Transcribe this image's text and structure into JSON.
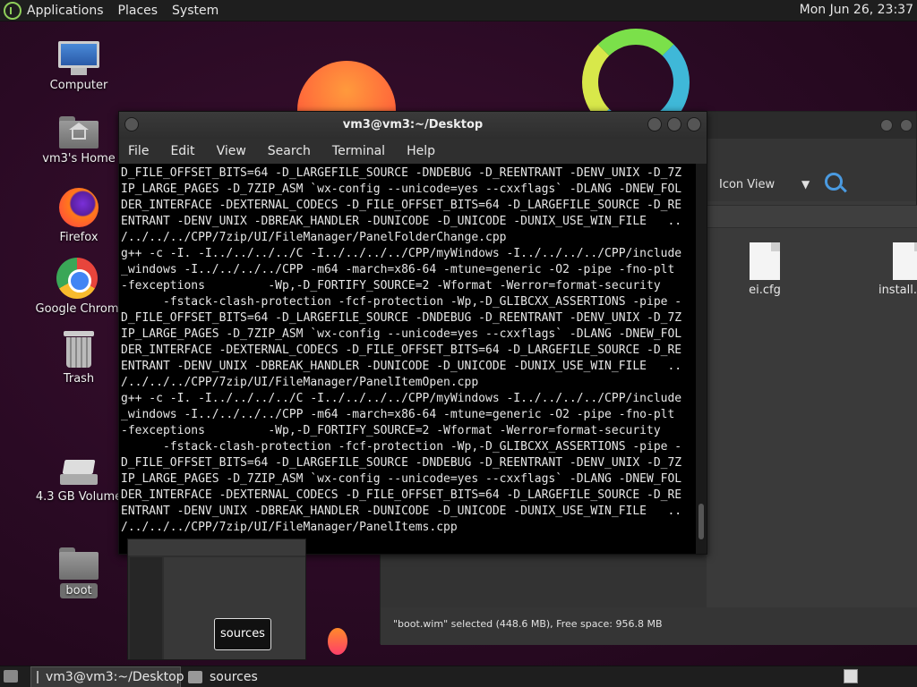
{
  "top_panel": {
    "menus": [
      "Applications",
      "Places",
      "System"
    ],
    "clock": "Mon Jun 26, 23:37"
  },
  "desktop_icons": [
    {
      "label": "Computer",
      "icon": "computer-icon"
    },
    {
      "label": "vm3's Home",
      "icon": "home-folder-icon"
    },
    {
      "label": "Firefox",
      "icon": "firefox-icon"
    },
    {
      "label": "Google Chrom",
      "icon": "chrome-icon"
    },
    {
      "label": "Trash",
      "icon": "trash-icon"
    },
    {
      "label": "4.3 GB Volume",
      "icon": "drive-icon"
    },
    {
      "label": "boot",
      "icon": "folder-icon"
    }
  ],
  "terminal": {
    "title": "vm3@vm3:~/Desktop",
    "menus": [
      "File",
      "Edit",
      "View",
      "Search",
      "Terminal",
      "Help"
    ],
    "lines": [
      "D_FILE_OFFSET_BITS=64 -D_LARGEFILE_SOURCE -DNDEBUG -D_REENTRANT -DENV_UNIX -D_7Z",
      "IP_LARGE_PAGES -D_7ZIP_ASM `wx-config --unicode=yes --cxxflags` -DLANG -DNEW_FOL",
      "DER_INTERFACE -DEXTERNAL_CODECS -D_FILE_OFFSET_BITS=64 -D_LARGEFILE_SOURCE -D_RE",
      "ENTRANT -DENV_UNIX -DBREAK_HANDLER -DUNICODE -D_UNICODE -DUNIX_USE_WIN_FILE   ..",
      "/../../../CPP/7zip/UI/FileManager/PanelFolderChange.cpp",
      "g++ -c -I. -I../../../../C -I../../../../CPP/myWindows -I../../../../CPP/include",
      "_windows -I../../../../CPP -m64 -march=x86-64 -mtune=generic -O2 -pipe -fno-plt",
      "-fexceptions         -Wp,-D_FORTIFY_SOURCE=2 -Wformat -Werror=format-security",
      "      -fstack-clash-protection -fcf-protection -Wp,-D_GLIBCXX_ASSERTIONS -pipe -",
      "D_FILE_OFFSET_BITS=64 -D_LARGEFILE_SOURCE -DNDEBUG -D_REENTRANT -DENV_UNIX -D_7Z",
      "IP_LARGE_PAGES -D_7ZIP_ASM `wx-config --unicode=yes --cxxflags` -DLANG -DNEW_FOL",
      "DER_INTERFACE -DEXTERNAL_CODECS -D_FILE_OFFSET_BITS=64 -D_LARGEFILE_SOURCE -D_RE",
      "ENTRANT -DENV_UNIX -DBREAK_HANDLER -DUNICODE -D_UNICODE -DUNIX_USE_WIN_FILE   ..",
      "/../../../CPP/7zip/UI/FileManager/PanelItemOpen.cpp",
      "g++ -c -I. -I../../../../C -I../../../../CPP/myWindows -I../../../../CPP/include",
      "_windows -I../../../../CPP -m64 -march=x86-64 -mtune=generic -O2 -pipe -fno-plt",
      "-fexceptions         -Wp,-D_FORTIFY_SOURCE=2 -Wformat -Werror=format-security",
      "      -fstack-clash-protection -fcf-protection -Wp,-D_GLIBCXX_ASSERTIONS -pipe -",
      "D_FILE_OFFSET_BITS=64 -D_LARGEFILE_SOURCE -DNDEBUG -D_REENTRANT -DENV_UNIX -D_7Z",
      "IP_LARGE_PAGES -D_7ZIP_ASM `wx-config --unicode=yes --cxxflags` -DLANG -DNEW_FOL",
      "DER_INTERFACE -DEXTERNAL_CODECS -D_FILE_OFFSET_BITS=64 -D_LARGEFILE_SOURCE -D_RE",
      "ENTRANT -DENV_UNIX -DBREAK_HANDLER -DUNICODE -D_UNICODE -DUNIX_USE_WIN_FILE   ..",
      "/../../../CPP/7zip/UI/FileManager/PanelItems.cpp"
    ]
  },
  "file_manager": {
    "view_mode": "Icon View",
    "files": [
      {
        "name": "ei.cfg",
        "icon": "file-icon"
      },
      {
        "name": "install.esd",
        "icon": "file-icon"
      }
    ],
    "status": "\"boot.wim\" selected (448.6 MB), Free space: 956.8 MB"
  },
  "preview": {
    "tooltip": "sources"
  },
  "taskbar": {
    "tasks": [
      {
        "label": "vm3@vm3:~/Desktop",
        "icon": "terminal-icon",
        "active": true
      },
      {
        "label": "sources",
        "icon": "folder-icon",
        "active": false
      }
    ]
  }
}
